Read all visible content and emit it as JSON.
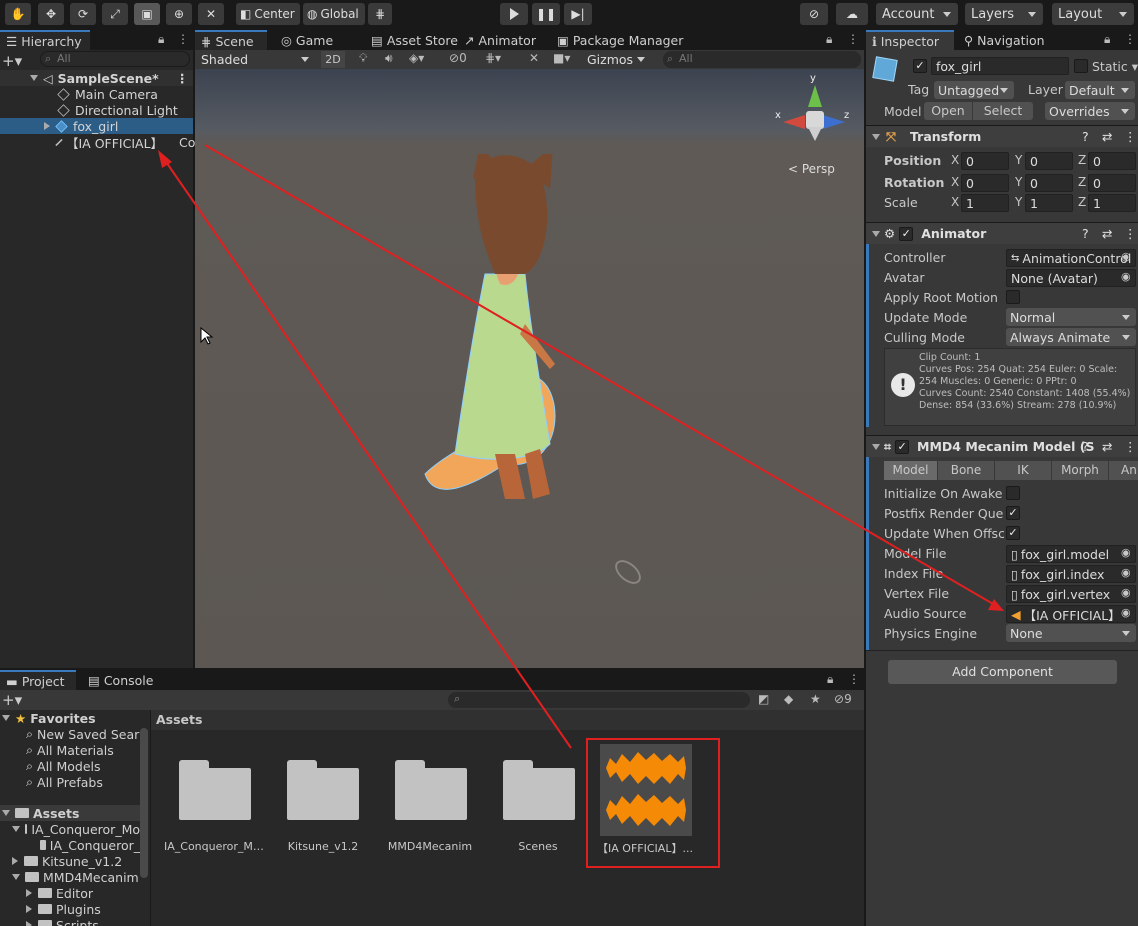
{
  "toolbar": {
    "center": "Center",
    "global": "Global",
    "account": "Account",
    "layers": "Layers",
    "layout": "Layout"
  },
  "hierarchy": {
    "tab": "Hierarchy",
    "search_placeholder": "All",
    "scene": "SampleScene*",
    "items": [
      "Main Camera",
      "Directional Light",
      "fox_girl",
      "【IA OFFICIAL】"
    ],
    "item_suffix": "Co"
  },
  "scene_tabs": [
    "Scene",
    "Game",
    "Asset Store",
    "Animator",
    "Package Manager"
  ],
  "scene_toolbar": {
    "shading": "Shaded",
    "mode_2d": "2D",
    "hidden_count": "0",
    "gizmos": "Gizmos",
    "search_placeholder": "All"
  },
  "scene_view": {
    "persp": "Persp",
    "axis_x": "x",
    "axis_y": "y",
    "axis_z": "z"
  },
  "inspector": {
    "tabs": [
      "Inspector",
      "Navigation"
    ],
    "object_name": "fox_girl",
    "static": "Static",
    "tag_label": "Tag",
    "tag": "Untagged",
    "layer_label": "Layer",
    "layer": "Default",
    "model_label": "Model",
    "open": "Open",
    "select": "Select",
    "overrides": "Overrides",
    "transform": {
      "title": "Transform",
      "rows": [
        {
          "label": "Position",
          "x": "0",
          "y": "0",
          "z": "0"
        },
        {
          "label": "Rotation",
          "x": "0",
          "y": "0",
          "z": "0"
        },
        {
          "label": "Scale",
          "x": "1",
          "y": "1",
          "z": "1"
        }
      ],
      "axis_x": "X",
      "axis_y": "Y",
      "axis_z": "Z"
    },
    "animator": {
      "title": "Animator",
      "controller_label": "Controller",
      "controller": "AnimationControl",
      "avatar_label": "Avatar",
      "avatar": "None (Avatar)",
      "apply_root_label": "Apply Root Motion",
      "update_mode_label": "Update Mode",
      "update_mode": "Normal",
      "culling_label": "Culling Mode",
      "culling": "Always Animate",
      "info": [
        "Clip Count: 1",
        "Curves Pos: 254 Quat: 254 Euler: 0 Scale:",
        "254 Muscles: 0 Generic: 0 PPtr: 0",
        "Curves Count: 2540 Constant: 1408 (55.4%)",
        "Dense: 854 (33.6%) Stream: 278 (10.9%)"
      ]
    },
    "mmd4": {
      "title": "MMD4 Mecanim Model (S",
      "tabs": [
        "Model",
        "Bone",
        "IK",
        "Morph",
        "Ani"
      ],
      "init_label": "Initialize On Awake",
      "postfix_label": "Postfix Render Queue",
      "update_offscreen_label": "Update When Offscre",
      "model_file_label": "Model File",
      "model_file": "fox_girl.model",
      "index_file_label": "Index File",
      "index_file": "fox_girl.index",
      "vertex_file_label": "Vertex File",
      "vertex_file": "fox_girl.vertex",
      "audio_label": "Audio Source",
      "audio": "【IA OFFICIAL】",
      "physics_label": "Physics Engine",
      "physics": "None"
    },
    "add_component": "Add Component"
  },
  "project": {
    "tabs": [
      "Project",
      "Console"
    ],
    "hidden_count": "9",
    "favorites": "Favorites",
    "fav_items": [
      "New Saved Sear",
      "All Materials",
      "All Models",
      "All Prefabs"
    ],
    "assets_root": "Assets",
    "tree": [
      "IA_Conqueror_Mo",
      "IA_Conqueror_",
      "Kitsune_v1.2",
      "MMD4Mecanim",
      "Editor",
      "Plugins",
      "Scripts"
    ],
    "breadcrumb": "Assets",
    "assets": [
      "IA_Conqueror_Mo...",
      "Kitsune_v1.2",
      "MMD4Mecanim",
      "Scenes",
      "【IA OFFICIAL】..."
    ]
  }
}
